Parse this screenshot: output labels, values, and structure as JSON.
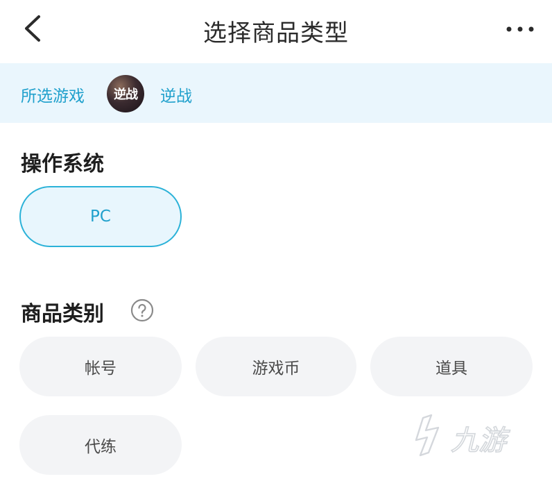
{
  "header": {
    "title": "选择商品类型",
    "back_icon": "chevron-left-icon",
    "more_icon": "more-horizontal-icon"
  },
  "selected_game": {
    "label": "所选游戏",
    "avatar_text": "逆战",
    "name": "逆战"
  },
  "os_section": {
    "title": "操作系统",
    "options": [
      {
        "label": "PC",
        "selected": true
      }
    ]
  },
  "category_section": {
    "title": "商品类别",
    "help_icon": "question-circle-icon",
    "options": [
      {
        "label": "帐号",
        "selected": false
      },
      {
        "label": "游戏币",
        "selected": false
      },
      {
        "label": "道具",
        "selected": false
      },
      {
        "label": "代练",
        "selected": false
      }
    ]
  },
  "watermark": {
    "text": "九游"
  },
  "colors": {
    "accent": "#1fa0cc",
    "accent_border": "#2bb2d8",
    "bar_bg": "#eaf6fd",
    "chip_bg": "#f3f4f6"
  }
}
